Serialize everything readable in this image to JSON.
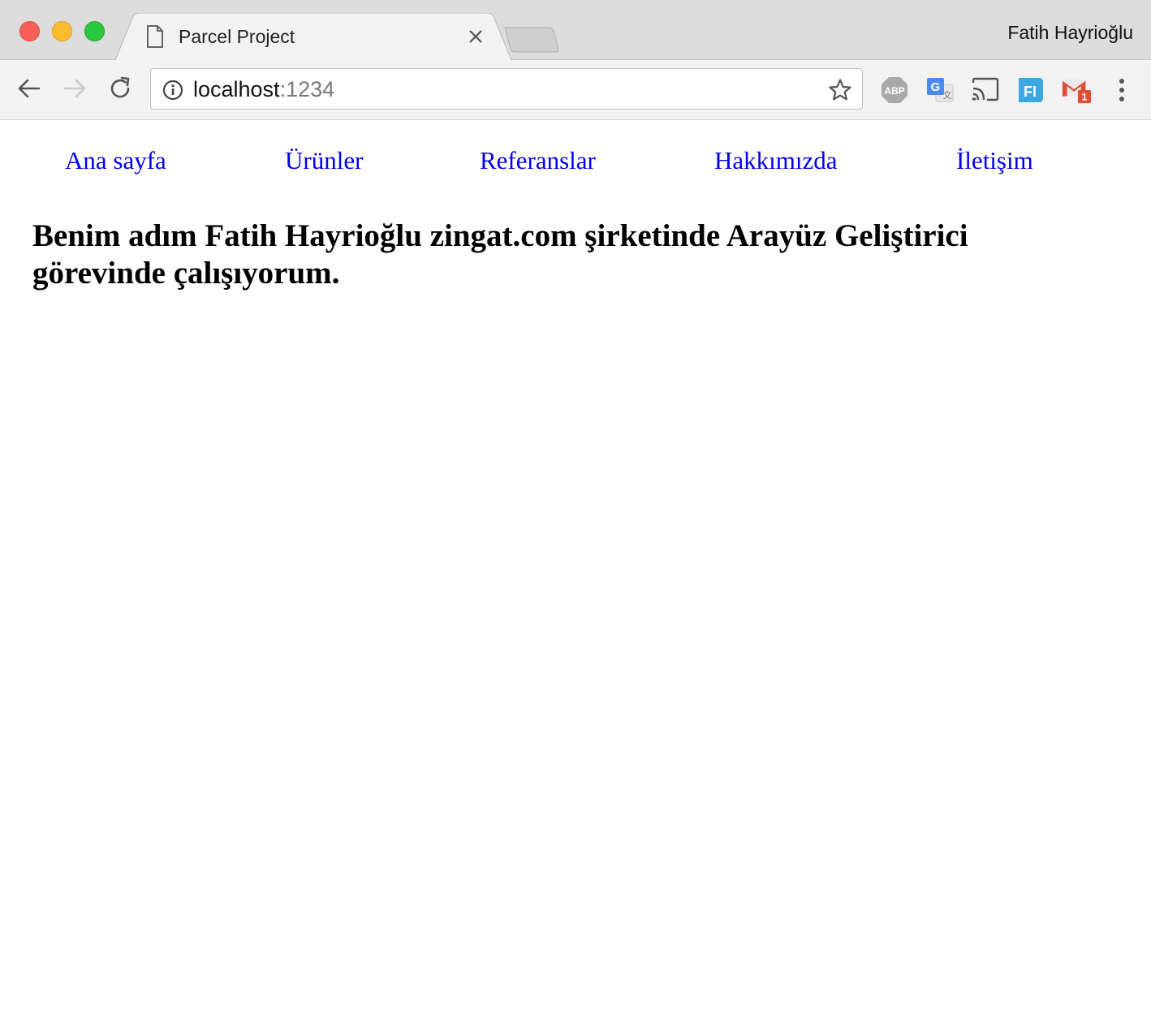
{
  "browser": {
    "tab_title": "Parcel Project",
    "profile_name": "Fatih Hayrioğlu",
    "url_host": "localhost",
    "url_port": ":1234",
    "extensions": {
      "abp_label": "ABP",
      "translate_label": "G",
      "fi_label": "FI",
      "gmail_badge": "1"
    }
  },
  "page": {
    "nav": [
      {
        "label": "Ana sayfa"
      },
      {
        "label": "Ürünler"
      },
      {
        "label": "Referanslar"
      },
      {
        "label": "Hakkımızda"
      },
      {
        "label": "İletişim"
      }
    ],
    "heading": "Benim adım Fatih Hayrioğlu zingat.com şirketinde Arayüz Geliştirici görevinde çalışıyorum."
  },
  "colors": {
    "link": "#0000ee",
    "close": "#fc5f57",
    "minimize": "#fdbc2e",
    "maximize": "#28c840"
  },
  "icons": [
    "close-window-icon",
    "minimize-window-icon",
    "maximize-window-icon",
    "file-icon",
    "close-icon",
    "back-arrow-icon",
    "forward-arrow-icon",
    "reload-icon",
    "info-icon",
    "star-icon",
    "adblock-icon",
    "translate-icon",
    "cast-icon",
    "fi-extension-icon",
    "gmail-icon",
    "menu-icon"
  ]
}
